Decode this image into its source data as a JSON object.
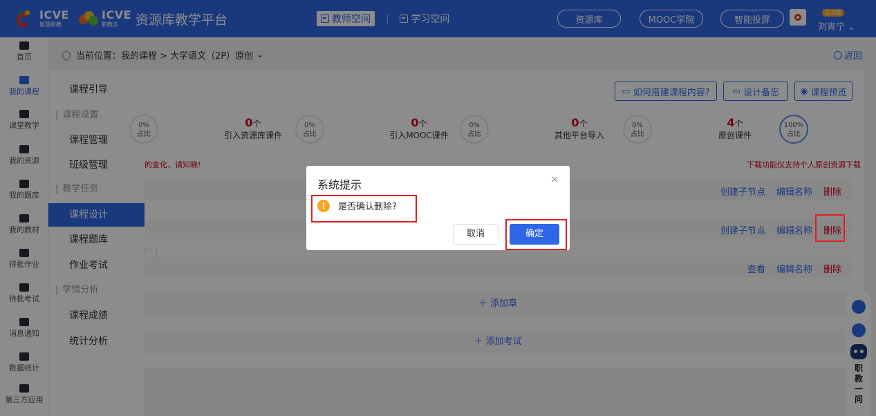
{
  "header": {
    "brand1_name": "ICVE",
    "brand1_sub": "智慧职教",
    "brand2_name": "ICVE",
    "brand2_sub": "职教云",
    "site_title": "资源库教学平台",
    "tab_teacher": "教师空间",
    "tab_study": "学习空间",
    "nav_buttons": [
      "资源库",
      "MOOC学院",
      "智能投屏"
    ],
    "version_badge": "正式版",
    "user_name": "刘宵宁",
    "colors": {
      "primary": "#2f66e6",
      "danger": "#d0021b",
      "warning": "#f5a623"
    }
  },
  "rail": [
    {
      "label": "首页",
      "icon": "home-icon"
    },
    {
      "label": "我的课程",
      "icon": "book-icon"
    },
    {
      "label": "课堂教学",
      "icon": "play-icon"
    },
    {
      "label": "我的资源",
      "icon": "folder-icon"
    },
    {
      "label": "我的题库",
      "icon": "question-bank-icon"
    },
    {
      "label": "我的教材",
      "icon": "textbook-icon"
    },
    {
      "label": "待批作业",
      "icon": "homework-icon"
    },
    {
      "label": "待批考试",
      "icon": "exam-icon"
    },
    {
      "label": "消息通知",
      "icon": "message-icon"
    },
    {
      "label": "数据统计",
      "icon": "stats-icon"
    },
    {
      "label": "第三方应用",
      "icon": "apps-icon"
    }
  ],
  "submenu": {
    "course_guide": "课程引导",
    "group_settings": "课程设置",
    "course_manage": "课程管理",
    "class_manage": "班级管理",
    "group_tasks": "教学任务",
    "course_design": "课程设计",
    "question_bank": "课程题库",
    "homework_exam": "作业考试",
    "group_analysis": "学情分析",
    "course_scores": "课程成绩",
    "stat_analysis": "统计分析"
  },
  "breadcrumb": {
    "text": "当前位置：我的课程 > 大学语文（2P）原创",
    "back": "返回"
  },
  "toolbar": {
    "how_to": "如何搭建课程内容?",
    "design_memo": "设计备忘",
    "preview": "课程预览"
  },
  "stats": {
    "s0_ring_val": "0%",
    "s0_ring_lbl": "占比",
    "s1_num": "0",
    "s1_unit": "个",
    "s1_label": "引入资源库课件",
    "s1_ring_val": "0%",
    "s1_ring_lbl": "占比",
    "s2_num": "0",
    "s2_unit": "个",
    "s2_label": "引入MOOC课件",
    "s2_ring_val": "0%",
    "s2_ring_lbl": "占比",
    "s3_num": "0",
    "s3_unit": "个",
    "s3_label": "其他平台导入",
    "s3_ring_val": "0%",
    "s3_ring_lbl": "占比",
    "s4_num": "4",
    "s4_unit": "个",
    "s4_label": "原创课件",
    "s4_ring_val": "100%",
    "s4_ring_lbl": "占比"
  },
  "notices": {
    "left": "的变化，请知晓!",
    "right": "下载功能仅支持个人原创资源下载"
  },
  "rows": {
    "r1": {
      "a1": "创建子节点",
      "a2": "编辑名称",
      "a3": "删除"
    },
    "r2": {
      "a1": "创建子节点",
      "a2": "编辑名称",
      "a3": "删除"
    },
    "r3": {
      "a1": "查看",
      "a2": "编辑名称",
      "a3": "删除"
    }
  },
  "add_chapter": "添加章",
  "add_exam": "添加考试",
  "collapse_glyph": "«",
  "dialog": {
    "title": "系统提示",
    "close": "×",
    "message": "是否确认删除?",
    "cancel": "取消",
    "confirm": "确定"
  },
  "float_widget": {
    "label": "职教一问"
  }
}
